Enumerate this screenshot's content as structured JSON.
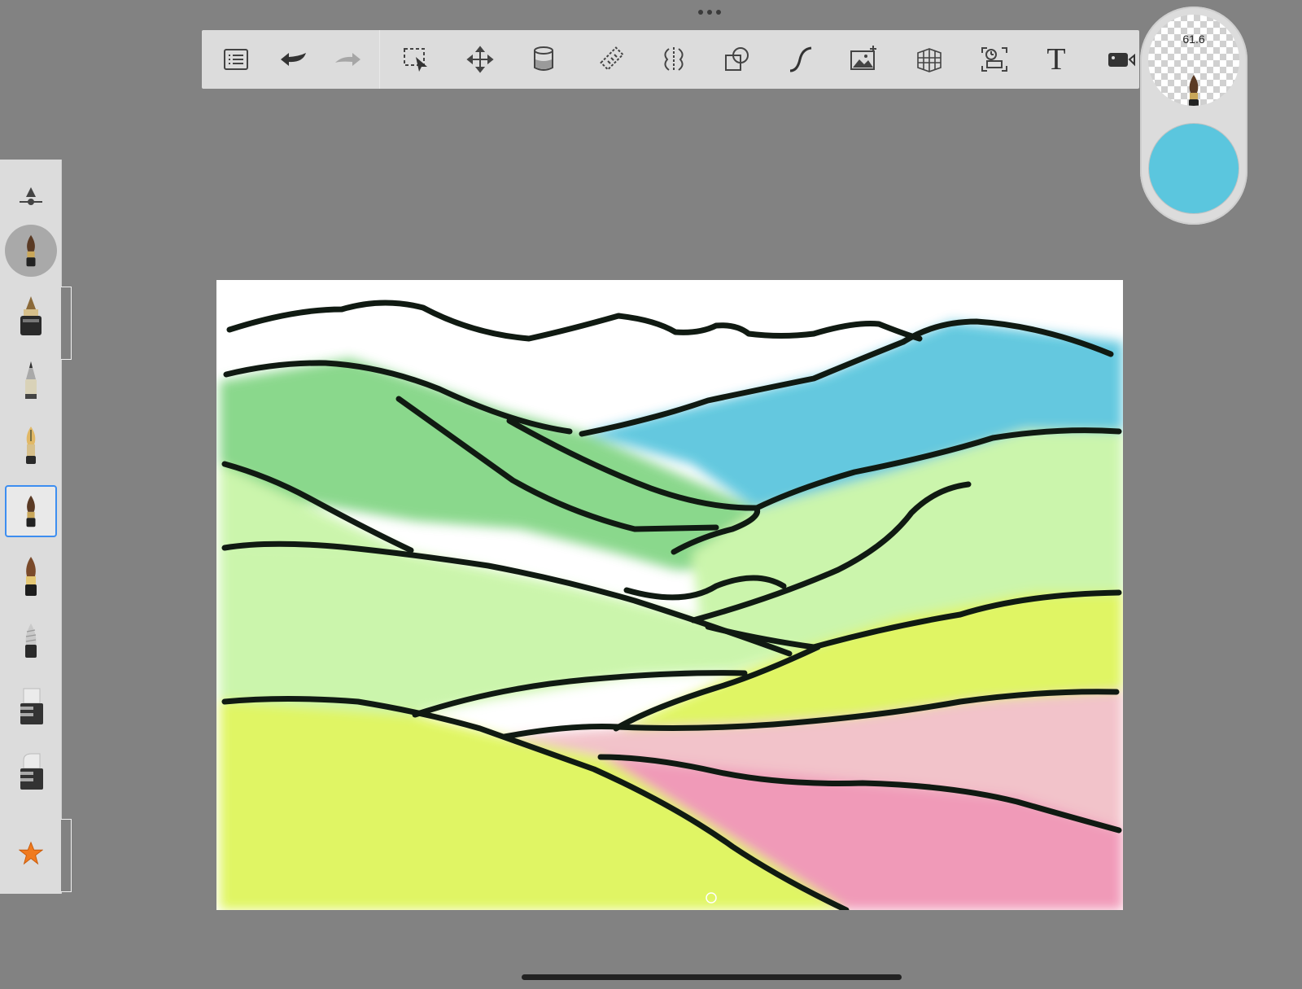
{
  "app": "Sketchbook",
  "toolbar": {
    "items": [
      {
        "name": "layer-list-icon"
      },
      {
        "name": "undo-icon"
      },
      {
        "name": "redo-icon"
      },
      {
        "name": "selection-icon"
      },
      {
        "name": "transform-icon"
      },
      {
        "name": "fill-icon"
      },
      {
        "name": "ruler-icon"
      },
      {
        "name": "symmetry-icon"
      },
      {
        "name": "shape-icon"
      },
      {
        "name": "curve-icon"
      },
      {
        "name": "image-add-icon"
      },
      {
        "name": "perspective-icon"
      },
      {
        "name": "timelapse-icon"
      },
      {
        "name": "text-icon",
        "label": "T"
      },
      {
        "name": "video-icon"
      }
    ]
  },
  "puck": {
    "brush_size": "61.6",
    "current_color": "#5bc6de"
  },
  "brush_palette": {
    "current_brush": "paintbrush",
    "selected_index": 3,
    "brushes": [
      "ink-pen",
      "pencil",
      "fountain-pen",
      "paintbrush",
      "marker",
      "airbrush",
      "eraser-hard",
      "eraser-soft"
    ],
    "favorites_icon": "star-icon"
  },
  "colors": {
    "background": "#828282",
    "toolbar": "#dcdcdc",
    "accent": "#3d8ef0",
    "sky_blue": "#5bc6de",
    "hill_dark_green": "#84d686",
    "hill_light_green": "#c9f5a8",
    "hill_yellow": "#dff55c",
    "hill_pink": "#f095b5",
    "ink": "#101a12"
  }
}
